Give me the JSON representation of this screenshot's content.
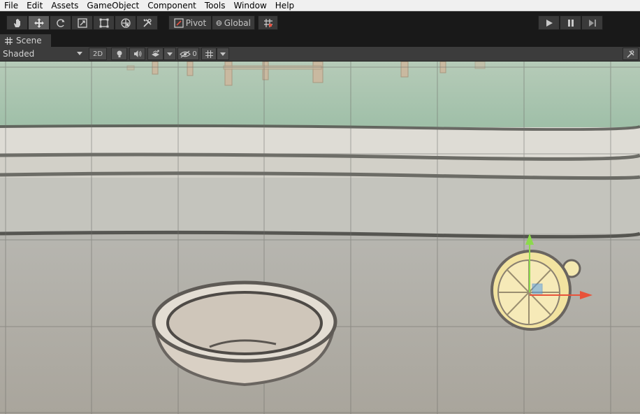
{
  "menu": {
    "items": [
      "File",
      "Edit",
      "Assets",
      "GameObject",
      "Component",
      "Tools",
      "Window",
      "Help"
    ]
  },
  "toolbar": {
    "tools": [
      "hand-tool-icon",
      "move-tool-icon",
      "rotate-tool-icon",
      "scale-tool-icon",
      "rect-tool-icon",
      "transform-tool-icon",
      "custom-tool-icon"
    ],
    "active_tool": "move-tool-icon",
    "pivot_label": "Pivot",
    "global_label": "Global",
    "snap_icon": "grid-snap-icon",
    "play_controls": [
      "play-icon",
      "pause-icon",
      "step-icon"
    ]
  },
  "tabs": {
    "scene_label": "Scene"
  },
  "scene_toolbar": {
    "draw_mode": "Shaded",
    "mode_2d": "2D",
    "hidden_count": "0",
    "icons": [
      "light-icon",
      "audio-icon",
      "effects-icon",
      "visibility-icon",
      "gizmos-icon"
    ]
  },
  "colors": {
    "menubar": "#f0f0f0",
    "toolbar": "#191919",
    "panel": "#3c3c3c",
    "gizmo_y": "#8cd94c",
    "gizmo_x": "#e8523a",
    "gizmo_z": "#5aa0e6"
  }
}
